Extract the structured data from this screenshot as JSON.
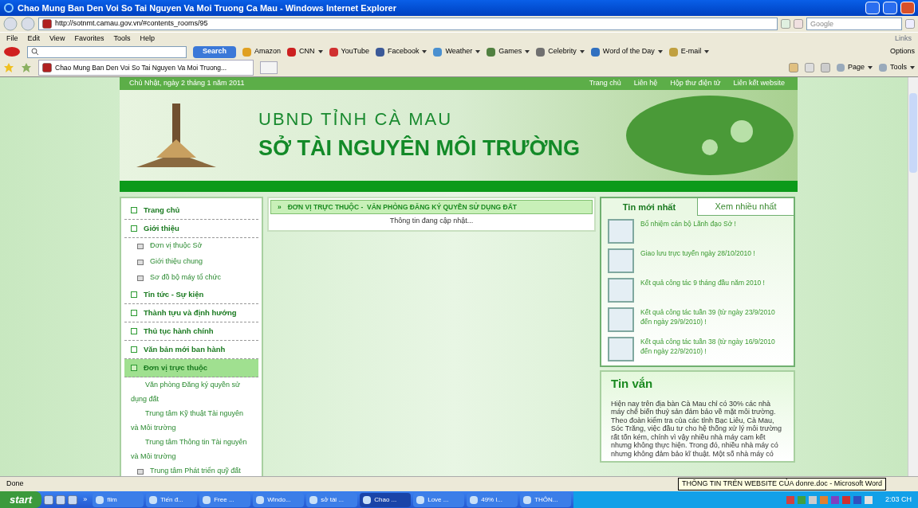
{
  "window": {
    "title": "Chao Mung Ban Den Voi So Tai Nguyen Va Moi Truong Ca Mau - Windows Internet Explorer"
  },
  "address_bar": {
    "url": "http://sotnmt.camau.gov.vn/#contents_rooms/95",
    "search_placeholder": "Google"
  },
  "menu": [
    "File",
    "Edit",
    "View",
    "Favorites",
    "Tools",
    "Help"
  ],
  "links_label": "Links",
  "toolbar": {
    "search_button": "Search",
    "items": [
      {
        "label": "Amazon",
        "dropdown": false,
        "color": "#e0a020"
      },
      {
        "label": "CNN",
        "dropdown": true,
        "color": "#cc2020"
      },
      {
        "label": "YouTube",
        "dropdown": false,
        "color": "#d03030"
      },
      {
        "label": "Facebook",
        "dropdown": true,
        "color": "#3b5998"
      },
      {
        "label": "Weather",
        "dropdown": true,
        "color": "#4a90d0"
      },
      {
        "label": "Games",
        "dropdown": true,
        "color": "#508040"
      },
      {
        "label": "Celebrity",
        "dropdown": true,
        "color": "#707070"
      },
      {
        "label": "Word of the Day",
        "dropdown": true,
        "color": "#3070c0"
      },
      {
        "label": "E-mail",
        "dropdown": true,
        "color": "#c0a040"
      }
    ],
    "options": "Options"
  },
  "tab": {
    "title": "Chao Mung Ban Den Voi So Tai Nguyen Va Moi Truong..."
  },
  "command_bar": [
    "Page",
    "Tools"
  ],
  "page": {
    "date": "Chủ Nhật, ngày 2 tháng 1 năm 2011",
    "top_links": [
      "Trang chủ",
      "Liên hệ",
      "Hộp thư điện tử",
      "Liên kết website"
    ],
    "banner_line1": "UBND TỈNH CÀ MAU",
    "banner_line2": "SỞ TÀI NGUYÊN MÔI TRƯỜNG"
  },
  "sidebar": {
    "items": [
      {
        "label": "Trang chủ",
        "selected": false
      },
      {
        "label": "Giới thiệu",
        "selected": false,
        "children": [
          {
            "label": "Đơn vị thuộc Sở",
            "kind": "bullet"
          },
          {
            "label": "Giới thiệu chung",
            "kind": "bullet"
          },
          {
            "label": "Sơ đồ bộ máy tổ chức",
            "kind": "bullet"
          }
        ]
      },
      {
        "label": "Tin tức - Sự kiện",
        "selected": false
      },
      {
        "label": "Thành tựu và định hướng",
        "selected": false
      },
      {
        "label": "Thủ tục hành chính",
        "selected": false
      },
      {
        "label": "Văn bản mới ban hành",
        "selected": false
      },
      {
        "label": "Đơn vị trực thuộc",
        "selected": true,
        "children": [
          {
            "label": "Văn phòng Đăng ký quyền sử dụng đất",
            "kind": "plain"
          },
          {
            "label": "Trung tâm Kỹ thuật Tài nguyên và Môi trường",
            "kind": "plain"
          },
          {
            "label": "Trung tâm Thông tin Tài nguyên và Môi trường",
            "kind": "plain"
          },
          {
            "label": "Trung tâm Phát triển quỹ đất",
            "kind": "bullet"
          }
        ]
      }
    ]
  },
  "content": {
    "marker": "»",
    "heading": "ĐƠN VỊ TRỰC THUỘC -  VĂN PHÒNG ĐĂNG KÝ QUYỀN SỬ DỤNG ĐẤT",
    "message": "Thông tin đang cập nhật..."
  },
  "news": {
    "tabs": [
      {
        "label": "Tin mới nhất",
        "selected": true
      },
      {
        "label": "Xem nhiều nhất",
        "selected": false
      }
    ],
    "items": [
      "Bổ nhiệm cán bộ Lãnh đạo Sở !",
      "Giao lưu trực tuyến ngày 28/10/2010 !",
      "Kết quả công tác 9 tháng đầu năm 2010 !",
      "Kết quả công tác tuần 39 (từ ngày 23/9/2010 đến ngày 29/9/2010) !",
      "Kết quả công tác tuần 38 (từ ngày 16/9/2010 đến ngày 22/9/2010) !"
    ]
  },
  "brief": {
    "title": "Tin vắn",
    "text": "Hiện nay trên địa bàn Cà Mau chỉ có 30% các nhà máy chế biến thuỷ sản đảm bảo về mặt môi trường. Theo đoàn kiểm tra của các tỉnh Bạc Liêu, Cà Mau, Sóc Trăng, việc đầu tư cho hệ thống xử lý môi trường rất tốn kém, chính vì vậy nhiều nhà máy cam kết nhưng không thực hiện. Trong đó, nhiều nhà máy có nhưng không đảm bảo kĩ thuật. Một số nhà máy có"
  },
  "status_bar": {
    "text": "Done",
    "tooltip": "THÔNG TIN TRÊN WEBSITE CỦA donre.doc - Microsoft Word"
  },
  "taskbar": {
    "start": "start",
    "overflow": "»",
    "buttons": [
      {
        "label": "film",
        "selected": false
      },
      {
        "label": "Tiến đ...",
        "selected": false
      },
      {
        "label": "Free ...",
        "selected": false
      },
      {
        "label": "Windo...",
        "selected": false
      },
      {
        "label": "sở tài ...",
        "selected": false
      },
      {
        "label": "Chao ...",
        "selected": true
      },
      {
        "label": "Love ...",
        "selected": false
      },
      {
        "label": "49% l...",
        "selected": false
      },
      {
        "label": "THÔN...",
        "selected": false
      }
    ],
    "clock": "2:03 CH"
  }
}
